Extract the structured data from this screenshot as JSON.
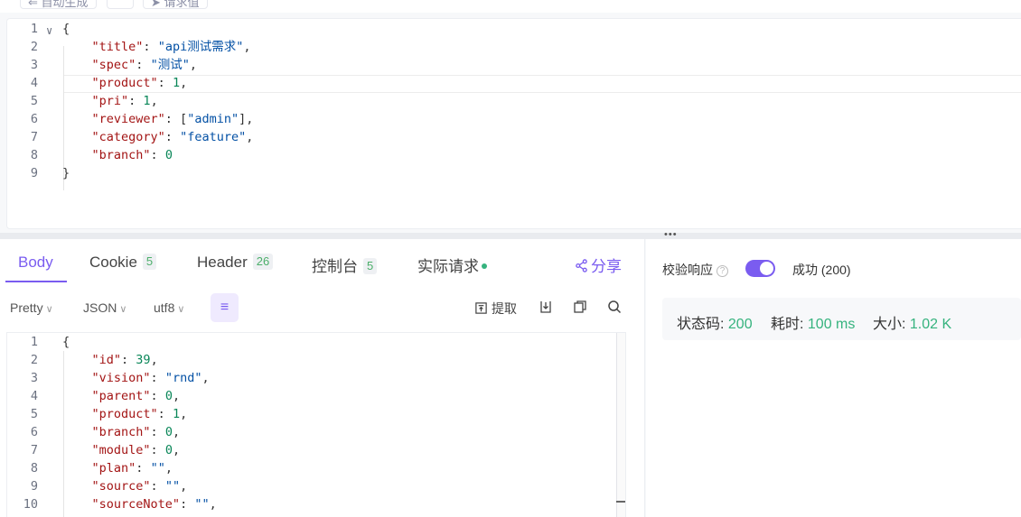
{
  "top_toolbar": {
    "left_button": "⇐ 自动生成",
    "mid_button": "",
    "right_button": "➤ 请求值"
  },
  "request_body": {
    "lines": [
      {
        "n": "1",
        "parts": [
          [
            "p",
            "{"
          ]
        ]
      },
      {
        "n": "2",
        "parts": [
          [
            "p",
            "    "
          ],
          [
            "k",
            "\"title\""
          ],
          [
            "p",
            ": "
          ],
          [
            "s",
            "\"api测试需求\""
          ],
          [
            "p",
            ","
          ]
        ]
      },
      {
        "n": "3",
        "parts": [
          [
            "p",
            "    "
          ],
          [
            "k",
            "\"spec\""
          ],
          [
            "p",
            ": "
          ],
          [
            "s",
            "\"测试\""
          ],
          [
            "p",
            ","
          ]
        ]
      },
      {
        "n": "4",
        "parts": [
          [
            "p",
            "    "
          ],
          [
            "k",
            "\"product\""
          ],
          [
            "p",
            ": "
          ],
          [
            "n",
            "1"
          ],
          [
            "p",
            ","
          ]
        ]
      },
      {
        "n": "5",
        "parts": [
          [
            "p",
            "    "
          ],
          [
            "k",
            "\"pri\""
          ],
          [
            "p",
            ": "
          ],
          [
            "n",
            "1"
          ],
          [
            "p",
            ","
          ]
        ]
      },
      {
        "n": "6",
        "parts": [
          [
            "p",
            "    "
          ],
          [
            "k",
            "\"reviewer\""
          ],
          [
            "p",
            ": ["
          ],
          [
            "s",
            "\"admin\""
          ],
          [
            "p",
            "],"
          ]
        ]
      },
      {
        "n": "7",
        "parts": [
          [
            "p",
            "    "
          ],
          [
            "k",
            "\"category\""
          ],
          [
            "p",
            ": "
          ],
          [
            "s",
            "\"feature\""
          ],
          [
            "p",
            ","
          ]
        ]
      },
      {
        "n": "8",
        "parts": [
          [
            "p",
            "    "
          ],
          [
            "k",
            "\"branch\""
          ],
          [
            "p",
            ": "
          ],
          [
            "n",
            "0"
          ]
        ]
      },
      {
        "n": "9",
        "parts": [
          [
            "p",
            "}"
          ]
        ]
      }
    ]
  },
  "response_tabs": {
    "body": "Body",
    "cookie": "Cookie",
    "cookie_count": "5",
    "header": "Header",
    "header_count": "26",
    "console": "控制台",
    "console_count": "5",
    "actual": "实际请求",
    "share": "分享"
  },
  "response_toolbar": {
    "format": "Pretty",
    "type": "JSON",
    "encoding": "utf8",
    "extract": "提取"
  },
  "response_body": {
    "lines": [
      {
        "n": "1",
        "parts": [
          [
            "p",
            "{"
          ]
        ]
      },
      {
        "n": "2",
        "parts": [
          [
            "p",
            "    "
          ],
          [
            "k",
            "\"id\""
          ],
          [
            "p",
            ": "
          ],
          [
            "n",
            "39"
          ],
          [
            "p",
            ","
          ]
        ]
      },
      {
        "n": "3",
        "parts": [
          [
            "p",
            "    "
          ],
          [
            "k",
            "\"vision\""
          ],
          [
            "p",
            ": "
          ],
          [
            "s",
            "\"rnd\""
          ],
          [
            "p",
            ","
          ]
        ]
      },
      {
        "n": "4",
        "parts": [
          [
            "p",
            "    "
          ],
          [
            "k",
            "\"parent\""
          ],
          [
            "p",
            ": "
          ],
          [
            "n",
            "0"
          ],
          [
            "p",
            ","
          ]
        ]
      },
      {
        "n": "5",
        "parts": [
          [
            "p",
            "    "
          ],
          [
            "k",
            "\"product\""
          ],
          [
            "p",
            ": "
          ],
          [
            "n",
            "1"
          ],
          [
            "p",
            ","
          ]
        ]
      },
      {
        "n": "6",
        "parts": [
          [
            "p",
            "    "
          ],
          [
            "k",
            "\"branch\""
          ],
          [
            "p",
            ": "
          ],
          [
            "n",
            "0"
          ],
          [
            "p",
            ","
          ]
        ]
      },
      {
        "n": "7",
        "parts": [
          [
            "p",
            "    "
          ],
          [
            "k",
            "\"module\""
          ],
          [
            "p",
            ": "
          ],
          [
            "n",
            "0"
          ],
          [
            "p",
            ","
          ]
        ]
      },
      {
        "n": "8",
        "parts": [
          [
            "p",
            "    "
          ],
          [
            "k",
            "\"plan\""
          ],
          [
            "p",
            ": "
          ],
          [
            "s",
            "\"\""
          ],
          [
            "p",
            ","
          ]
        ]
      },
      {
        "n": "9",
        "parts": [
          [
            "p",
            "    "
          ],
          [
            "k",
            "\"source\""
          ],
          [
            "p",
            ": "
          ],
          [
            "s",
            "\"\""
          ],
          [
            "p",
            ","
          ]
        ]
      },
      {
        "n": "10",
        "parts": [
          [
            "p",
            "    "
          ],
          [
            "k",
            "\"sourceNote\""
          ],
          [
            "p",
            ": "
          ],
          [
            "s",
            "\"\""
          ],
          [
            "p",
            ","
          ]
        ]
      }
    ]
  },
  "validation": {
    "label": "校验响应",
    "enabled": true,
    "result": "成功 (200)"
  },
  "stats": {
    "status_label": "状态码:",
    "status_value": "200",
    "time_label": "耗时:",
    "time_value": "100 ms",
    "size_label": "大小:",
    "size_value": "1.02 K"
  },
  "colors": {
    "accent": "#7a5cf0",
    "success": "#36b37e",
    "json_key": "#a31515",
    "json_string": "#0451a5",
    "json_number": "#098658"
  }
}
